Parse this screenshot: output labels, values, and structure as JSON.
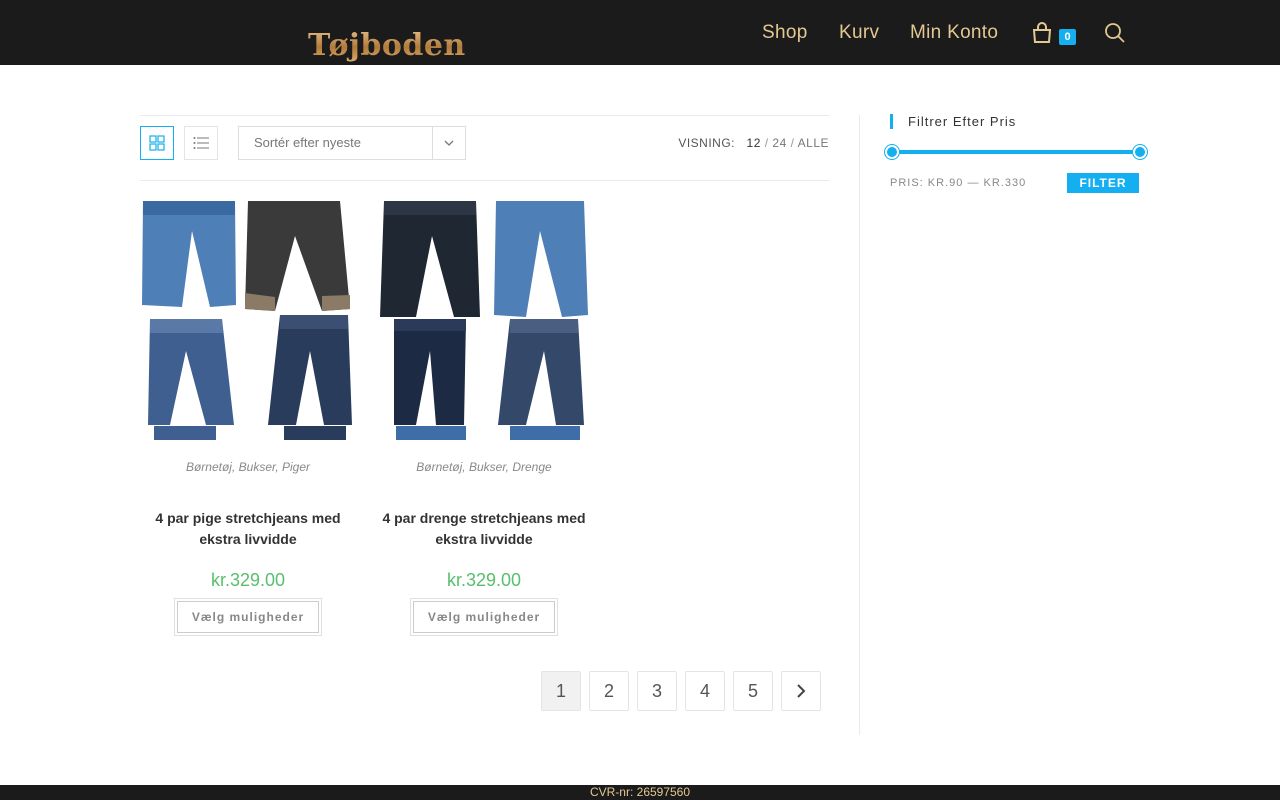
{
  "header": {
    "logo_text": "Tøjboden",
    "nav": [
      {
        "label": "Shop"
      },
      {
        "label": "Kurv"
      },
      {
        "label": "Min Konto"
      }
    ],
    "cart_count": "0",
    "icons": {
      "cart": "shopping-bag-icon",
      "search": "search-icon"
    }
  },
  "toolbar": {
    "grid_icon": "grid-view-icon",
    "list_icon": "list-view-icon",
    "sort_selected": "Sortér efter nyeste",
    "visning_label": "VISNING:",
    "per_page": [
      "12",
      "24",
      "ALLE"
    ]
  },
  "products": [
    {
      "categories": "Børnetøj, Bukser, Piger",
      "title": "4 par pige stretchjeans med ekstra livvidde",
      "price": "kr.329.00",
      "button": "Vælg muligheder"
    },
    {
      "categories": "Børnetøj, Bukser, Drenge",
      "title": "4 par drenge stretchjeans med ekstra livvidde",
      "price": "kr.329.00",
      "button": "Vælg muligheder"
    }
  ],
  "pagination": {
    "pages": [
      "1",
      "2",
      "3",
      "4",
      "5"
    ],
    "current": "1",
    "next_icon": "chevron-right-icon"
  },
  "sidebar": {
    "title": "Filtrer Efter Pris",
    "price_label": "PRIS:",
    "price_min": "KR.90",
    "price_dash": "—",
    "price_max": "KR.330",
    "filter_button": "FILTER"
  },
  "footer": {
    "text": "CVR-nr: 26597560"
  },
  "colors": {
    "accent": "#13aff0",
    "nav_text": "#e3c891",
    "price": "#57bf6d",
    "header_bg": "#1b1b1b"
  }
}
